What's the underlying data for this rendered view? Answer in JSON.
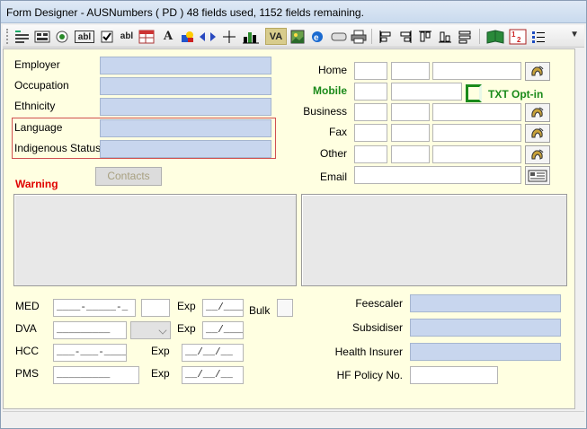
{
  "window": {
    "title": "Form Designer - AUSNumbers ( PD ) 48 fields used, 1152 fields remaining."
  },
  "toolbar": {
    "va_label": "VA",
    "text_a_label": "A",
    "abl_label": "abl",
    "abl2_label": "abl"
  },
  "left": {
    "employer": {
      "label": "Employer",
      "value": ""
    },
    "occupation": {
      "label": "Occupation",
      "value": ""
    },
    "ethnicity": {
      "label": "Ethnicity",
      "value": ""
    },
    "language": {
      "label": "Language",
      "value": ""
    },
    "indigenous_status": {
      "label": "Indigenous Status",
      "value": ""
    },
    "contacts_button": "Contacts",
    "warning": "Warning"
  },
  "phones": {
    "home": "Home",
    "mobile": "Mobile",
    "business": "Business",
    "fax": "Fax",
    "other": "Other",
    "email": "Email",
    "txt_optin": "TXT Opt-in"
  },
  "bottom": {
    "med": {
      "label": "MED",
      "mask": "____-_____-_",
      "exp_label": "Exp",
      "exp_mask": "__/____",
      "bulk_label": "Bulk"
    },
    "dva": {
      "label": "DVA",
      "mask": "_________",
      "exp_label": "Exp",
      "exp_mask": "__/____"
    },
    "hcc": {
      "label": "HCC",
      "mask": "___-___-_____",
      "exp_label": "Exp",
      "exp_mask": "__/__/__"
    },
    "pms": {
      "label": "PMS",
      "mask": "_________",
      "exp_label": "Exp",
      "exp_mask": "__/__/__"
    },
    "feescaler": "Feescaler",
    "subsidiser": "Subsidiser",
    "health_insurer": "Health Insurer",
    "hf_policy": "HF Policy No."
  },
  "colors": {
    "form_bg": "#ffffe1",
    "field_blue": "#c8d6ee",
    "warning": "#e00000",
    "mobile_green": "#1a8a1a"
  }
}
